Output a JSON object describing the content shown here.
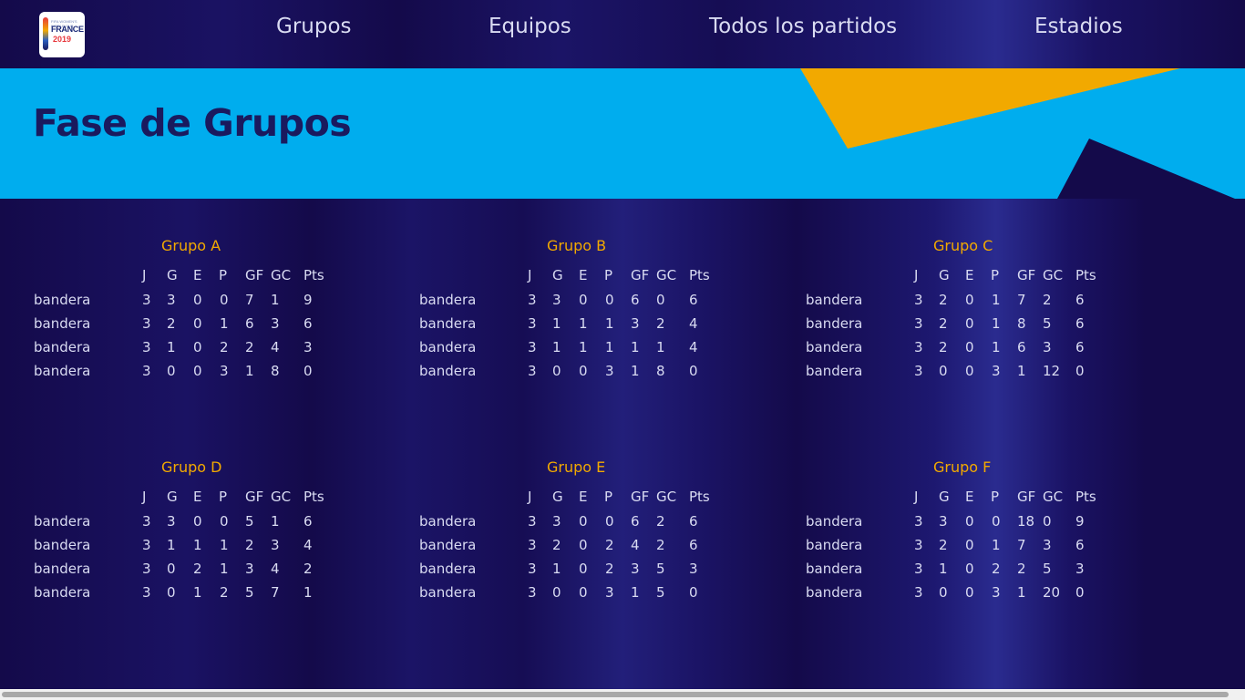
{
  "logo": {
    "line0": "FIFA WOMEN'S WORLD CUP",
    "line1": "FRANCE",
    "line2": "2019"
  },
  "nav": {
    "items": [
      {
        "label": "Grupos"
      },
      {
        "label": "Equipos"
      },
      {
        "label": "Todos los partidos"
      },
      {
        "label": "Estadios"
      }
    ]
  },
  "banner": {
    "title": "Fase de Grupos"
  },
  "headers": [
    "J",
    "G",
    "E",
    "P",
    "GF",
    "GC",
    "Pts"
  ],
  "groups": [
    {
      "title": "Grupo A",
      "rows": [
        {
          "team": "bandera",
          "stats": [
            "3",
            "3",
            "0",
            "0",
            "7",
            "1",
            "9"
          ]
        },
        {
          "team": "bandera",
          "stats": [
            "3",
            "2",
            "0",
            "1",
            "6",
            "3",
            "6"
          ]
        },
        {
          "team": "bandera",
          "stats": [
            "3",
            "1",
            "0",
            "2",
            "2",
            "4",
            "3"
          ]
        },
        {
          "team": "bandera",
          "stats": [
            "3",
            "0",
            "0",
            "3",
            "1",
            "8",
            "0"
          ]
        }
      ]
    },
    {
      "title": "Grupo B",
      "rows": [
        {
          "team": "bandera",
          "stats": [
            "3",
            "3",
            "0",
            "0",
            "6",
            "0",
            "6"
          ]
        },
        {
          "team": "bandera",
          "stats": [
            "3",
            "1",
            "1",
            "1",
            "3",
            "2",
            "4"
          ]
        },
        {
          "team": "bandera",
          "stats": [
            "3",
            "1",
            "1",
            "1",
            "1",
            "1",
            "4"
          ]
        },
        {
          "team": "bandera",
          "stats": [
            "3",
            "0",
            "0",
            "3",
            "1",
            "8",
            "0"
          ]
        }
      ]
    },
    {
      "title": "Grupo C",
      "rows": [
        {
          "team": "bandera",
          "stats": [
            "3",
            "2",
            "0",
            "1",
            "7",
            "2",
            "6"
          ]
        },
        {
          "team": "bandera",
          "stats": [
            "3",
            "2",
            "0",
            "1",
            "8",
            "5",
            "6"
          ]
        },
        {
          "team": "bandera",
          "stats": [
            "3",
            "2",
            "0",
            "1",
            "6",
            "3",
            "6"
          ]
        },
        {
          "team": "bandera",
          "stats": [
            "3",
            "0",
            "0",
            "3",
            "1",
            "12",
            "0"
          ]
        }
      ]
    },
    {
      "title": "Grupo D",
      "rows": [
        {
          "team": "bandera",
          "stats": [
            "3",
            "3",
            "0",
            "0",
            "5",
            "1",
            "6"
          ]
        },
        {
          "team": "bandera",
          "stats": [
            "3",
            "1",
            "1",
            "1",
            "2",
            "3",
            "4"
          ]
        },
        {
          "team": "bandera",
          "stats": [
            "3",
            "0",
            "2",
            "1",
            "3",
            "4",
            "2"
          ]
        },
        {
          "team": "bandera",
          "stats": [
            "3",
            "0",
            "1",
            "2",
            "5",
            "7",
            "1"
          ]
        }
      ]
    },
    {
      "title": "Grupo E",
      "rows": [
        {
          "team": "bandera",
          "stats": [
            "3",
            "3",
            "0",
            "0",
            "6",
            "2",
            "6"
          ]
        },
        {
          "team": "bandera",
          "stats": [
            "3",
            "2",
            "0",
            "2",
            "4",
            "2",
            "6"
          ]
        },
        {
          "team": "bandera",
          "stats": [
            "3",
            "1",
            "0",
            "2",
            "3",
            "5",
            "3"
          ]
        },
        {
          "team": "bandera",
          "stats": [
            "3",
            "0",
            "0",
            "3",
            "1",
            "5",
            "0"
          ]
        }
      ]
    },
    {
      "title": "Grupo F",
      "rows": [
        {
          "team": "bandera",
          "stats": [
            "3",
            "3",
            "0",
            "0",
            "18",
            "0",
            "9"
          ]
        },
        {
          "team": "bandera",
          "stats": [
            "3",
            "2",
            "0",
            "1",
            "7",
            "3",
            "6"
          ]
        },
        {
          "team": "bandera",
          "stats": [
            "3",
            "1",
            "0",
            "2",
            "2",
            "5",
            "3"
          ]
        },
        {
          "team": "bandera",
          "stats": [
            "3",
            "0",
            "0",
            "3",
            "1",
            "20",
            "0"
          ]
        }
      ]
    }
  ],
  "colors": {
    "nav_bg": "#140a4a",
    "banner_bg": "#00adee",
    "accent_orange": "#f2a900",
    "title_navy": "#1a1a5e",
    "group_title": "#f2a900",
    "text_light": "#d9dbf2"
  }
}
